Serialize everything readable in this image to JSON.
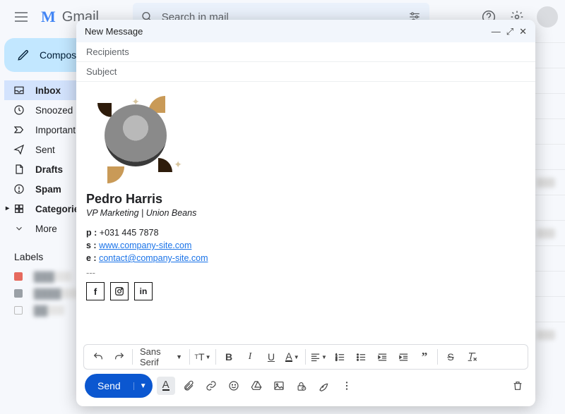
{
  "app": {
    "name": "Gmail"
  },
  "search": {
    "placeholder": "Search in mail"
  },
  "compose_button": "Compose",
  "sidebar": {
    "items": [
      {
        "label": "Inbox",
        "icon": "inbox-icon",
        "active": true,
        "bold": true
      },
      {
        "label": "Snoozed",
        "icon": "clock-icon",
        "active": false,
        "bold": false
      },
      {
        "label": "Important",
        "icon": "important-icon",
        "active": false,
        "bold": false
      },
      {
        "label": "Sent",
        "icon": "send-icon",
        "active": false,
        "bold": false
      },
      {
        "label": "Drafts",
        "icon": "draft-icon",
        "active": false,
        "bold": true
      },
      {
        "label": "Spam",
        "icon": "spam-icon",
        "active": false,
        "bold": true
      },
      {
        "label": "Categories",
        "icon": "categories-icon",
        "active": false,
        "bold": true
      },
      {
        "label": "More",
        "icon": "chevron-down-icon",
        "active": false,
        "bold": false
      }
    ],
    "labels_header": "Labels"
  },
  "compose": {
    "title": "New Message",
    "recipients_placeholder": "Recipients",
    "subject_placeholder": "Subject",
    "font_family": "Sans Serif",
    "send_label": "Send"
  },
  "signature": {
    "name": "Pedro Harris",
    "title": "VP Marketing | Union Beans",
    "phone_key": "p :",
    "phone": "+031 445 7878",
    "site_key": "s :",
    "site": "www.company-site.com",
    "email_key": "e :",
    "email": "contact@company-site.com",
    "separator": "---",
    "social": [
      "facebook",
      "instagram",
      "linkedin"
    ]
  }
}
